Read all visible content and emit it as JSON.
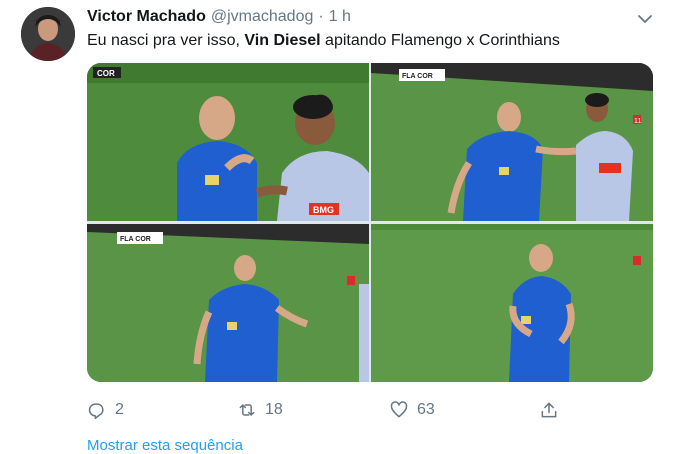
{
  "tweet": {
    "author_name": "Victor Machado",
    "author_handle": "@jvmachadog",
    "separator": "·",
    "time": "1 h",
    "text_before": "Eu nasci pra ver isso, ",
    "text_bold": "Vin Diesel",
    "text_after": " apitando Flamengo x Corinthians"
  },
  "media": {
    "images": [
      {
        "id": "photo-1",
        "scoreboard": "COR"
      },
      {
        "id": "photo-2",
        "scoreboard": "FLA COR"
      },
      {
        "id": "photo-3",
        "scoreboard": "FLA COR"
      },
      {
        "id": "photo-4",
        "scoreboard": ""
      }
    ],
    "channel_badge": "11",
    "shirt_sponsor": "BMG"
  },
  "actions": {
    "reply": {
      "icon": "reply-icon",
      "count": "2"
    },
    "retweet": {
      "icon": "retweet-icon",
      "count": "18"
    },
    "like": {
      "icon": "heart-icon",
      "count": "63"
    },
    "share": {
      "icon": "share-icon"
    }
  },
  "thread_link": "Mostrar esta sequência",
  "colors": {
    "text": "#14171a",
    "secondary": "#657786",
    "link": "#1da1f2",
    "field": "#4c8a3a",
    "referee_shirt": "#1f5fd0"
  }
}
